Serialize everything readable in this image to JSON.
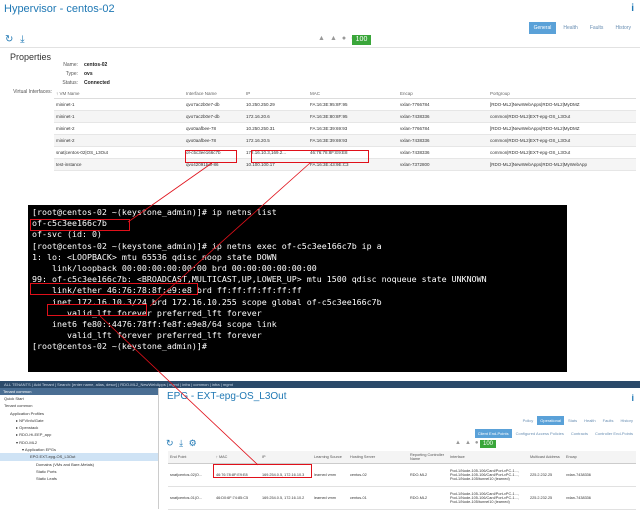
{
  "hypervisor": {
    "title": "Hypervisor - centos-02",
    "info_icon": "i",
    "tabs": [
      "General",
      "Health",
      "Faults",
      "History"
    ],
    "health_score": "100",
    "properties_title": "Properties",
    "props": [
      {
        "key": "Name:",
        "value": "centos-02"
      },
      {
        "key": "Type:",
        "value": "ovs"
      },
      {
        "key": "Status:",
        "value": "Connected"
      }
    ],
    "vif_label": "Virtual Interfaces:",
    "columns": [
      "↑ VM Name",
      "Interface Name",
      "IP",
      "MAC",
      "Encap",
      "Portgroup"
    ],
    "rows": [
      [
        "mininet-1",
        "qvo7ac2b0e7-db",
        "10.250.250.29",
        "FA:16:3E:95:8F:95",
        "vxlan-7766784",
        "[RDO-ML2]NewWebApps|RDO-ML2|MyDMZ"
      ],
      [
        "mininet-1",
        "qvo7ac2b0e7-db",
        "172.16.20.6",
        "FA:16:3E:80:8F:95",
        "vxlan-7438336",
        "common|RDO-ML2|EXT-epg-OS_L3Out"
      ],
      [
        "mininet-2",
        "qvo0aafbee-78",
        "10.250.250.31",
        "FA:16:3E:39:69:93",
        "vxlan-7766784",
        "[RDO-ML2]NewWebApps|RDO-ML2|MyDMZ"
      ],
      [
        "mininet-2",
        "qvo0aafbee-78",
        "172.16.20.5",
        "FA:16:3E:39:69:93",
        "vxlan-7438336",
        "common|RDO-ML2|EXT-epg-OS_L3Out"
      ],
      [
        "snat|centos-02|OS_L3Out",
        "of-c5c3ee166c7b",
        "172.16.10.3,169.2...",
        "46:76:78:8F:E9:E8",
        "vxlan-7438336",
        "common|RDO-ML2|EXT-epg-OS_L3Out"
      ],
      [
        "test-instance",
        "qvo42091bdf-86",
        "10.100.100.17",
        "FA:16:3E:43:9E:C3",
        "vxlan-7372800",
        "[RDO-ML2]NewWebApps|RDO-ML2|MyWebApp"
      ]
    ]
  },
  "terminal": {
    "lines": [
      "[root@centos-02 ~(keystone_admin)]# ip netns list",
      "of-c5c3ee166c7b",
      "of-svc (id: 0)",
      "[root@centos-02 ~(keystone_admin)]# ip netns exec of-c5c3ee166c7b ip a",
      "1: lo: <LOOPBACK> mtu 65536 qdisc noop state DOWN",
      "    link/loopback 00:00:00:00:00:00 brd 00:00:00:00:00:00",
      "99: of-c5c3ee166c7b: <BROADCAST,MULTICAST,UP,LOWER_UP> mtu 1500 qdisc noqueue state UNKNOWN",
      "    link/ether 46:76:78:8f:e9:e8 brd ff:ff:ff:ff:ff:ff",
      "    inet 172.16.10.3/24 brd 172.16.10.255 scope global of-c5c3ee166c7b",
      "       valid_lft forever preferred_lft forever",
      "    inet6 fe80::4476:78ff:fe8f:e9e8/64 scope link",
      "       valid_lft forever preferred_lft forever",
      "[root@centos-02 ~(keystone_admin)]# "
    ]
  },
  "apic": {
    "topbar": "ALL TENANTS | Add Tenant | Search: [enter name, alias, descr] | RDO-ML2_NewWebApps | mgmt | infra | common | infra | mgmt",
    "tree_header": "Tenant common",
    "tree": [
      "Quick Start",
      "Tenant common",
      "Application Profiles",
      "▸ NFVInfo/Gate",
      "▸ Openstack",
      "▸ RDO-Hi-EEP_app",
      "▾ RDO-ML2",
      "▾ Application EPGs",
      "EPG EXT-epg-OS_L3Out",
      "Domains (VMs and Bare-Metals)",
      "Static Ports",
      "Static Leafs"
    ],
    "epg_title": "EPG - EXT-epg-OS_L3Out",
    "info_icon": "i",
    "tabs_main": [
      "Policy",
      "Operational",
      "Stats",
      "Health",
      "Faults",
      "History"
    ],
    "tabs_sub": [
      "Client End-Points",
      "Configured Access Policies",
      "Contracts",
      "Controller End-Points"
    ],
    "health_score": "100",
    "columns": [
      "End Point",
      "↑ MAC",
      "IP",
      "Learning Source",
      "Hosting Server",
      "Reporting Controller Name",
      "Interface",
      "Multicast Address",
      "Encap"
    ],
    "rows": [
      [
        "snat|centos-02|O...",
        "46:76:78:8F:E9:E8",
        "169.254.0.5, 172.16.10.3",
        "learned vmm",
        "centos-02",
        "RDO-ML2",
        "Pod-1/Node-105-106/Card/Port-vPC-1..., Pod-1/Node-105-106/Card/Port-vPC-1..., Pod-1/Node-105/tunnel10 (learned)",
        "225.2.232.25",
        "vxlan-7438336"
      ],
      [
        "snat|centos-01|O...",
        "46:D0:6F:74:85:C5",
        "169.254.0.5, 172.16.10.2",
        "learned vmm",
        "centos-01",
        "RDO-ML2",
        "Pod-1/Node-105-106/Card/Port-vPC-1..., Pod-1/Node-105-106/Card/Port-vPC-1..., Pod-1/Node-105/tunnel10 (learned)",
        "225.2.232.25",
        "vxlan-7438336"
      ]
    ]
  }
}
